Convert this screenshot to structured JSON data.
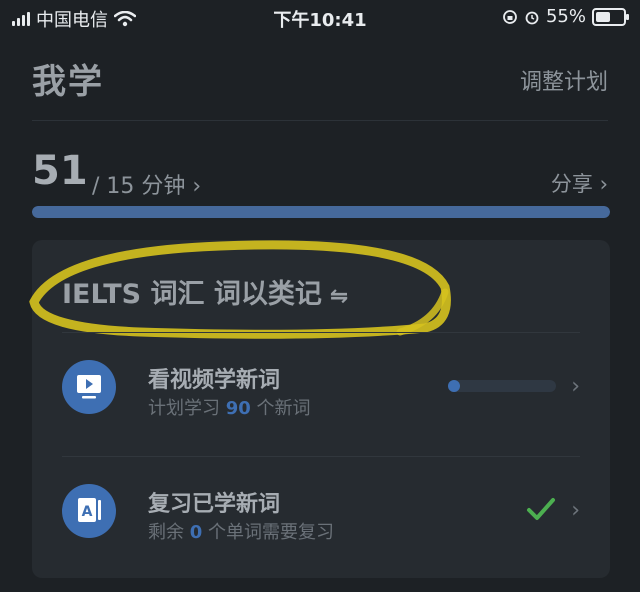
{
  "status_bar": {
    "carrier": "中国电信",
    "time": "下午10:41",
    "battery_percent": "55%",
    "battery_level": 0.55
  },
  "header": {
    "title": "我学",
    "adjust_plan": "调整计划"
  },
  "progress": {
    "current": "51",
    "target": "/ 15 分钟 ›",
    "share": "分享 ›",
    "fill_fraction": 1.0
  },
  "card": {
    "title": "IELTS 词汇  词以类记",
    "swap_icon": "⇋",
    "tasks": [
      {
        "title": "看视频学新词",
        "sub_prefix": "计划学习 ",
        "sub_num": "90",
        "sub_suffix": " 个新词",
        "icon": "video-icon",
        "progress": 0.0
      },
      {
        "title": "复习已学新词",
        "sub_prefix": "剩余 ",
        "sub_num": "0",
        "sub_suffix": " 个单词需要复习",
        "icon": "flashcard-icon",
        "done": true
      }
    ]
  },
  "colors": {
    "accent": "#3e6fb3",
    "progress": "#46699b",
    "check": "#4caf50",
    "highlight": "#d6c21e"
  }
}
